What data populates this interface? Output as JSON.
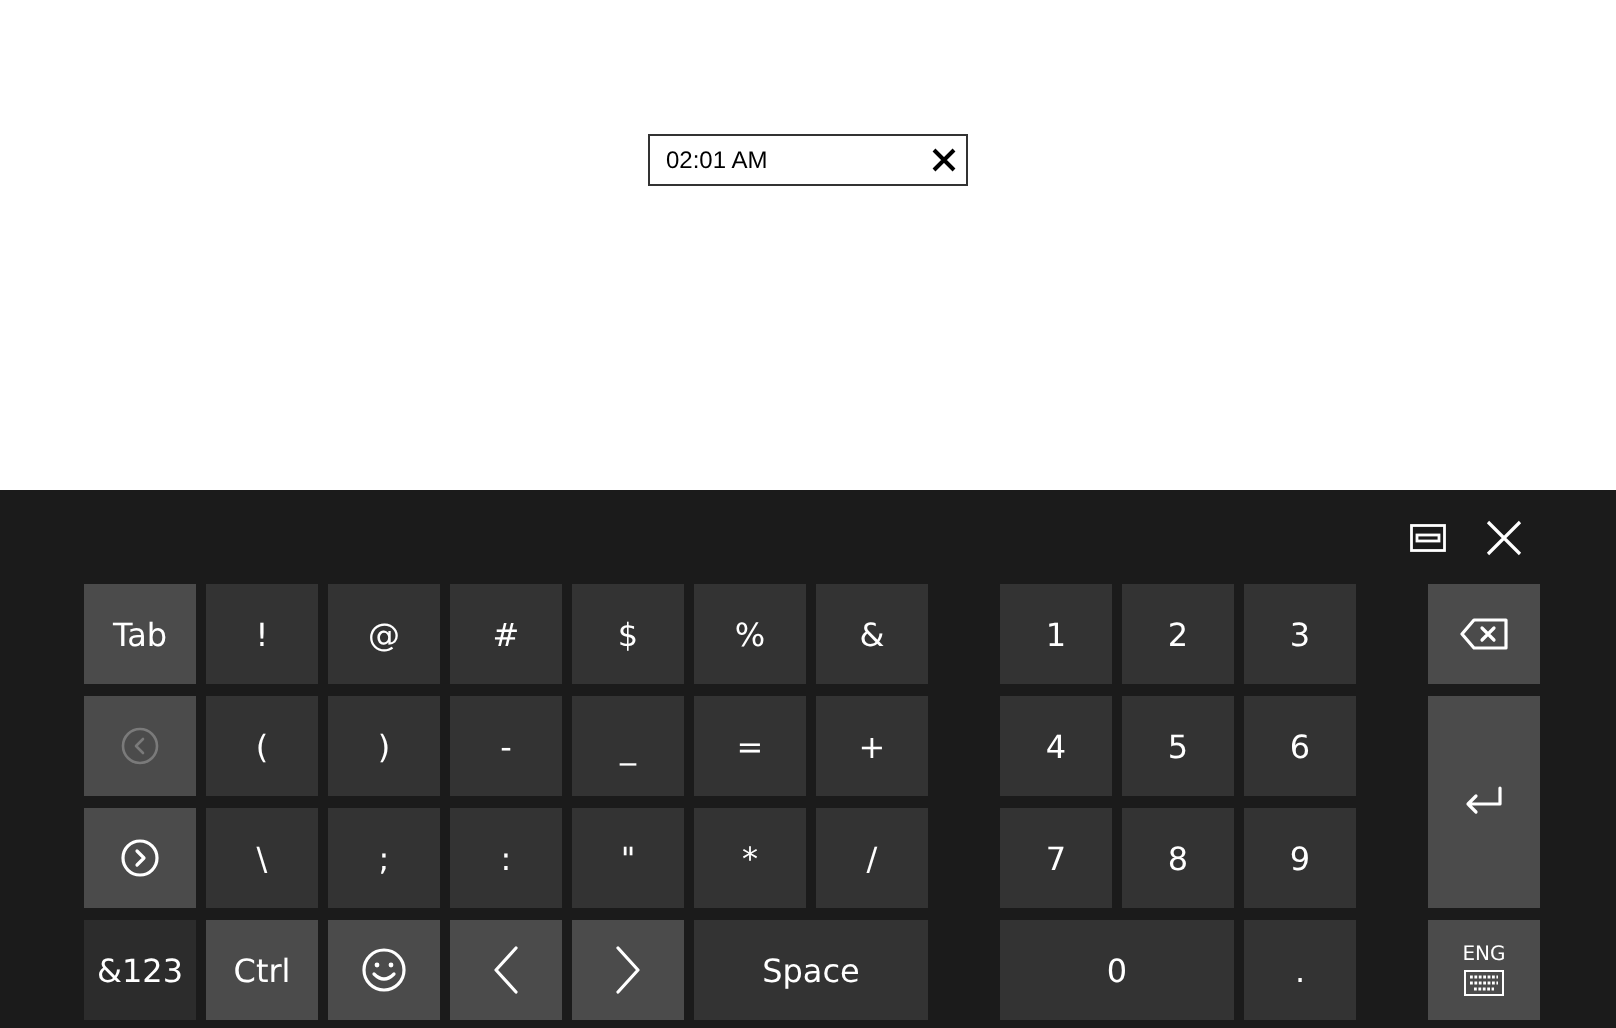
{
  "time_field": {
    "value": "02:01 AM"
  },
  "keyboard": {
    "symbol_keys": [
      {
        "kind": "func",
        "label": "Tab",
        "disabled": false
      },
      {
        "kind": "char",
        "label": "!",
        "disabled": false
      },
      {
        "kind": "char",
        "label": "@",
        "disabled": false
      },
      {
        "kind": "char",
        "label": "#",
        "disabled": false
      },
      {
        "kind": "char",
        "label": "$",
        "disabled": false
      },
      {
        "kind": "char",
        "label": "%",
        "disabled": false
      },
      {
        "kind": "char",
        "label": "&",
        "disabled": false
      },
      {
        "kind": "back",
        "disabled": true
      },
      {
        "kind": "char",
        "label": "(",
        "disabled": false
      },
      {
        "kind": "char",
        "label": ")",
        "disabled": false
      },
      {
        "kind": "char",
        "label": "-",
        "disabled": false
      },
      {
        "kind": "char",
        "label": "_",
        "disabled": false
      },
      {
        "kind": "char",
        "label": "=",
        "disabled": false
      },
      {
        "kind": "char",
        "label": "+",
        "disabled": false
      },
      {
        "kind": "forward",
        "disabled": false
      },
      {
        "kind": "char",
        "label": "\\",
        "disabled": false
      },
      {
        "kind": "char",
        "label": ";",
        "disabled": false
      },
      {
        "kind": "char",
        "label": ":",
        "disabled": false
      },
      {
        "kind": "char",
        "label": "\"",
        "disabled": false
      },
      {
        "kind": "char",
        "label": "*",
        "disabled": false
      },
      {
        "kind": "char",
        "label": "/",
        "disabled": false
      },
      {
        "kind": "mode",
        "label": "&123",
        "disabled": false
      },
      {
        "kind": "func",
        "label": "Ctrl",
        "disabled": false
      },
      {
        "kind": "emoji",
        "disabled": false
      },
      {
        "kind": "left",
        "disabled": false
      },
      {
        "kind": "right",
        "disabled": false
      },
      {
        "kind": "wide",
        "label": "Space",
        "disabled": false
      }
    ],
    "number_keys": [
      {
        "kind": "char",
        "label": "1"
      },
      {
        "kind": "char",
        "label": "2"
      },
      {
        "kind": "char",
        "label": "3"
      },
      {
        "kind": "char",
        "label": "4"
      },
      {
        "kind": "char",
        "label": "5"
      },
      {
        "kind": "char",
        "label": "6"
      },
      {
        "kind": "char",
        "label": "7"
      },
      {
        "kind": "char",
        "label": "8"
      },
      {
        "kind": "char",
        "label": "9"
      },
      {
        "kind": "wide",
        "label": "0"
      },
      {
        "kind": "char",
        "label": "."
      }
    ],
    "side_keys": [
      {
        "kind": "backspace"
      },
      {
        "kind": "enter"
      },
      {
        "kind": "language",
        "label": "ENG"
      }
    ]
  }
}
